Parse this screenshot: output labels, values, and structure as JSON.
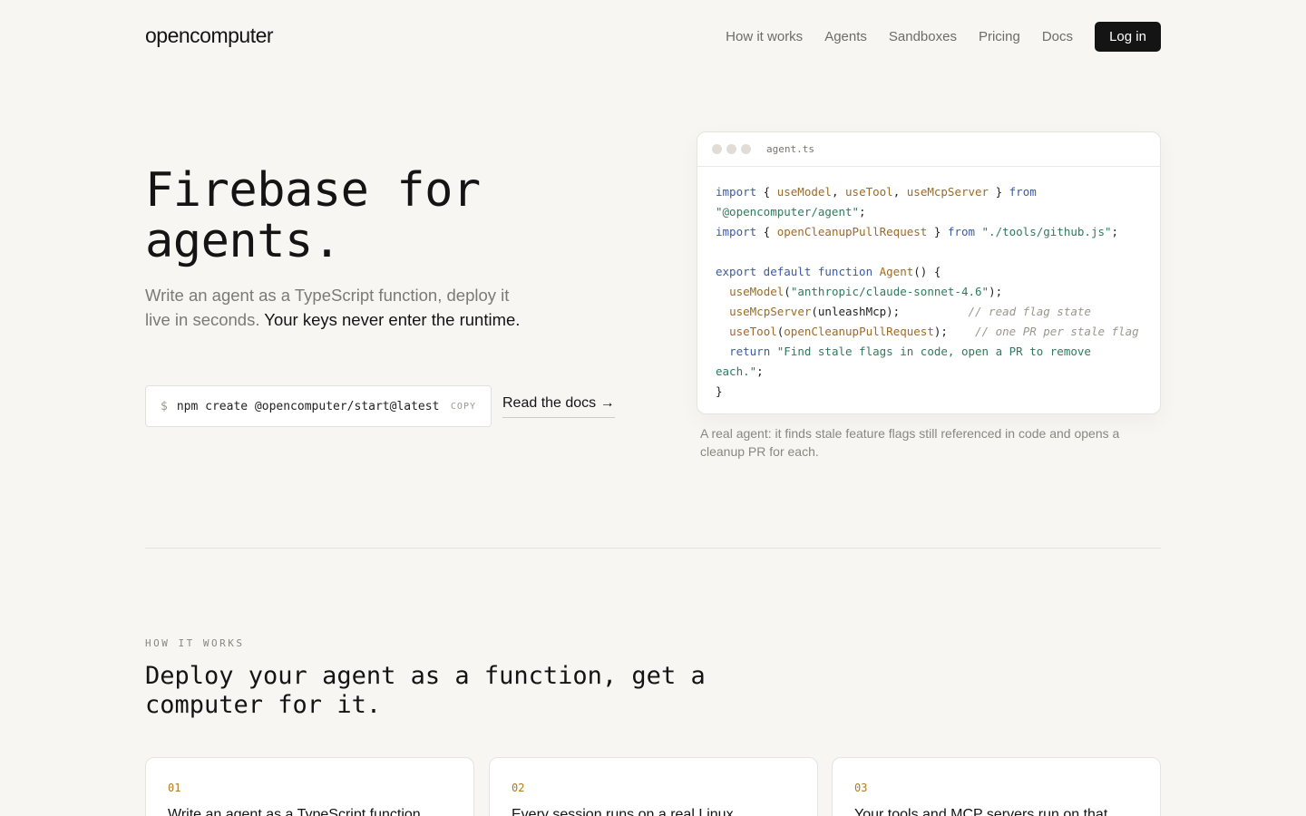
{
  "nav": {
    "logo": "opencomputer",
    "links": [
      "How it works",
      "Agents",
      "Sandboxes",
      "Pricing",
      "Docs"
    ],
    "login": "Log in"
  },
  "hero": {
    "title_line1": "Firebase for",
    "title_line2": "agents.",
    "subtitle_plain": "Write an agent as a TypeScript function, deploy it live in seconds.",
    "subtitle_strong": "Your keys never enter the runtime.",
    "command_prompt": "$",
    "command": "npm create @opencomputer/start@latest",
    "copy_label": "COPY",
    "docs_link": "Read the docs →"
  },
  "code": {
    "filename": "agent.ts",
    "caption": "A real agent: it finds stale feature flags still referenced in code and opens a cleanup PR for each."
  },
  "how_it_works": {
    "eyebrow": "HOW IT WORKS",
    "title": "Deploy your agent as a function, get a computer for it.",
    "cards": [
      {
        "num": "01",
        "text": "Write an agent as a TypeScript function"
      },
      {
        "num": "02",
        "text": "Every session runs on a real Linux"
      },
      {
        "num": "03",
        "text": "Your tools and MCP servers run on that"
      }
    ]
  }
}
